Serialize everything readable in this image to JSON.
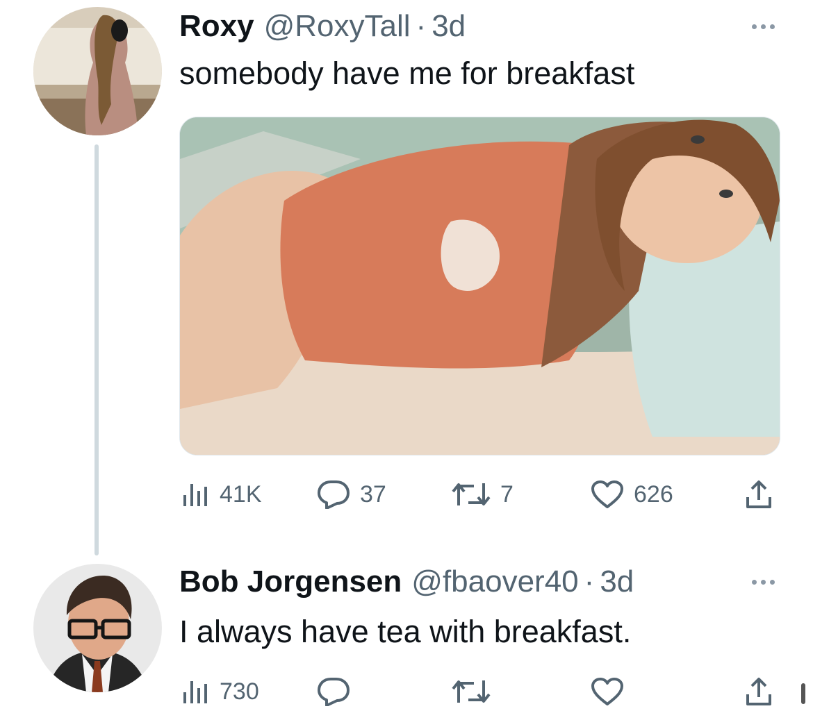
{
  "tweets": [
    {
      "display_name": "Roxy",
      "handle": "@RoxyTall",
      "separator": "·",
      "time": "3d",
      "text": "somebody have me for breakfast",
      "stats": {
        "views": "41K",
        "replies": "37",
        "retweets": "7",
        "likes": "626"
      }
    },
    {
      "display_name": "Bob Jorgensen",
      "handle": "@fbaover40",
      "separator": "·",
      "time": "3d",
      "text": "I always have tea with breakfast.",
      "stats": {
        "views": "730",
        "replies": "",
        "retweets": "",
        "likes": ""
      }
    }
  ],
  "icons": {
    "views": "bar-chart-icon",
    "reply": "speech-bubble-icon",
    "retweet": "retweet-arrows-icon",
    "like": "heart-icon",
    "share": "share-upload-icon",
    "more": "ellipsis-icon"
  },
  "colors": {
    "text": "#0f1419",
    "secondary": "#536471",
    "thread_line": "#cfd9de"
  }
}
